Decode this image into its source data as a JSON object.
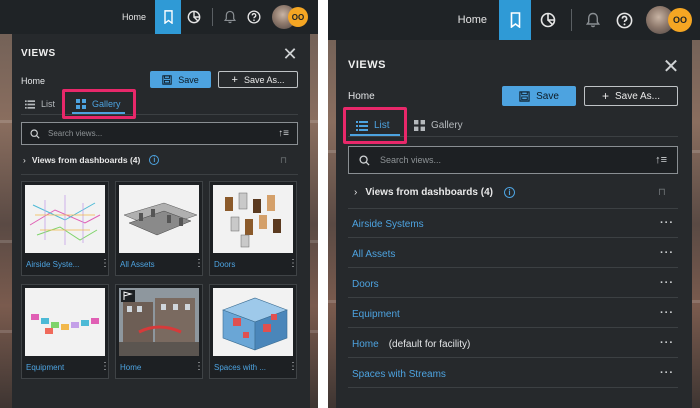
{
  "topbar": {
    "home_label": "Home",
    "avatar_initials": "OO",
    "icons": [
      "bookmark-icon",
      "dashboard-pie-icon",
      "bell-icon",
      "help-icon"
    ]
  },
  "panel": {
    "title": "VIEWS",
    "current_view": "Home",
    "save_label": "Save",
    "save_as_label": "Save As...",
    "tabs": {
      "list": "List",
      "gallery": "Gallery"
    },
    "search_placeholder": "Search views...",
    "section_label": "Views from dashboards (4)"
  },
  "gallery": {
    "cards": [
      {
        "label": "Airside Syste..."
      },
      {
        "label": "All Assets"
      },
      {
        "label": "Doors"
      },
      {
        "label": "Equipment"
      },
      {
        "label": "Home"
      },
      {
        "label": "Spaces with ..."
      }
    ]
  },
  "list": {
    "items": [
      {
        "name": "Airside Systems",
        "note": ""
      },
      {
        "name": "All Assets",
        "note": ""
      },
      {
        "name": "Doors",
        "note": ""
      },
      {
        "name": "Equipment",
        "note": ""
      },
      {
        "name": "Home",
        "note": "(default for facility)"
      },
      {
        "name": "Spaces with Streams",
        "note": ""
      }
    ]
  },
  "colors": {
    "accent": "#4da3e0",
    "highlight": "#e8286a",
    "panel_bg": "#26292c",
    "topbar_bg": "#1f2326",
    "avatar_bg": "#f5a623"
  }
}
